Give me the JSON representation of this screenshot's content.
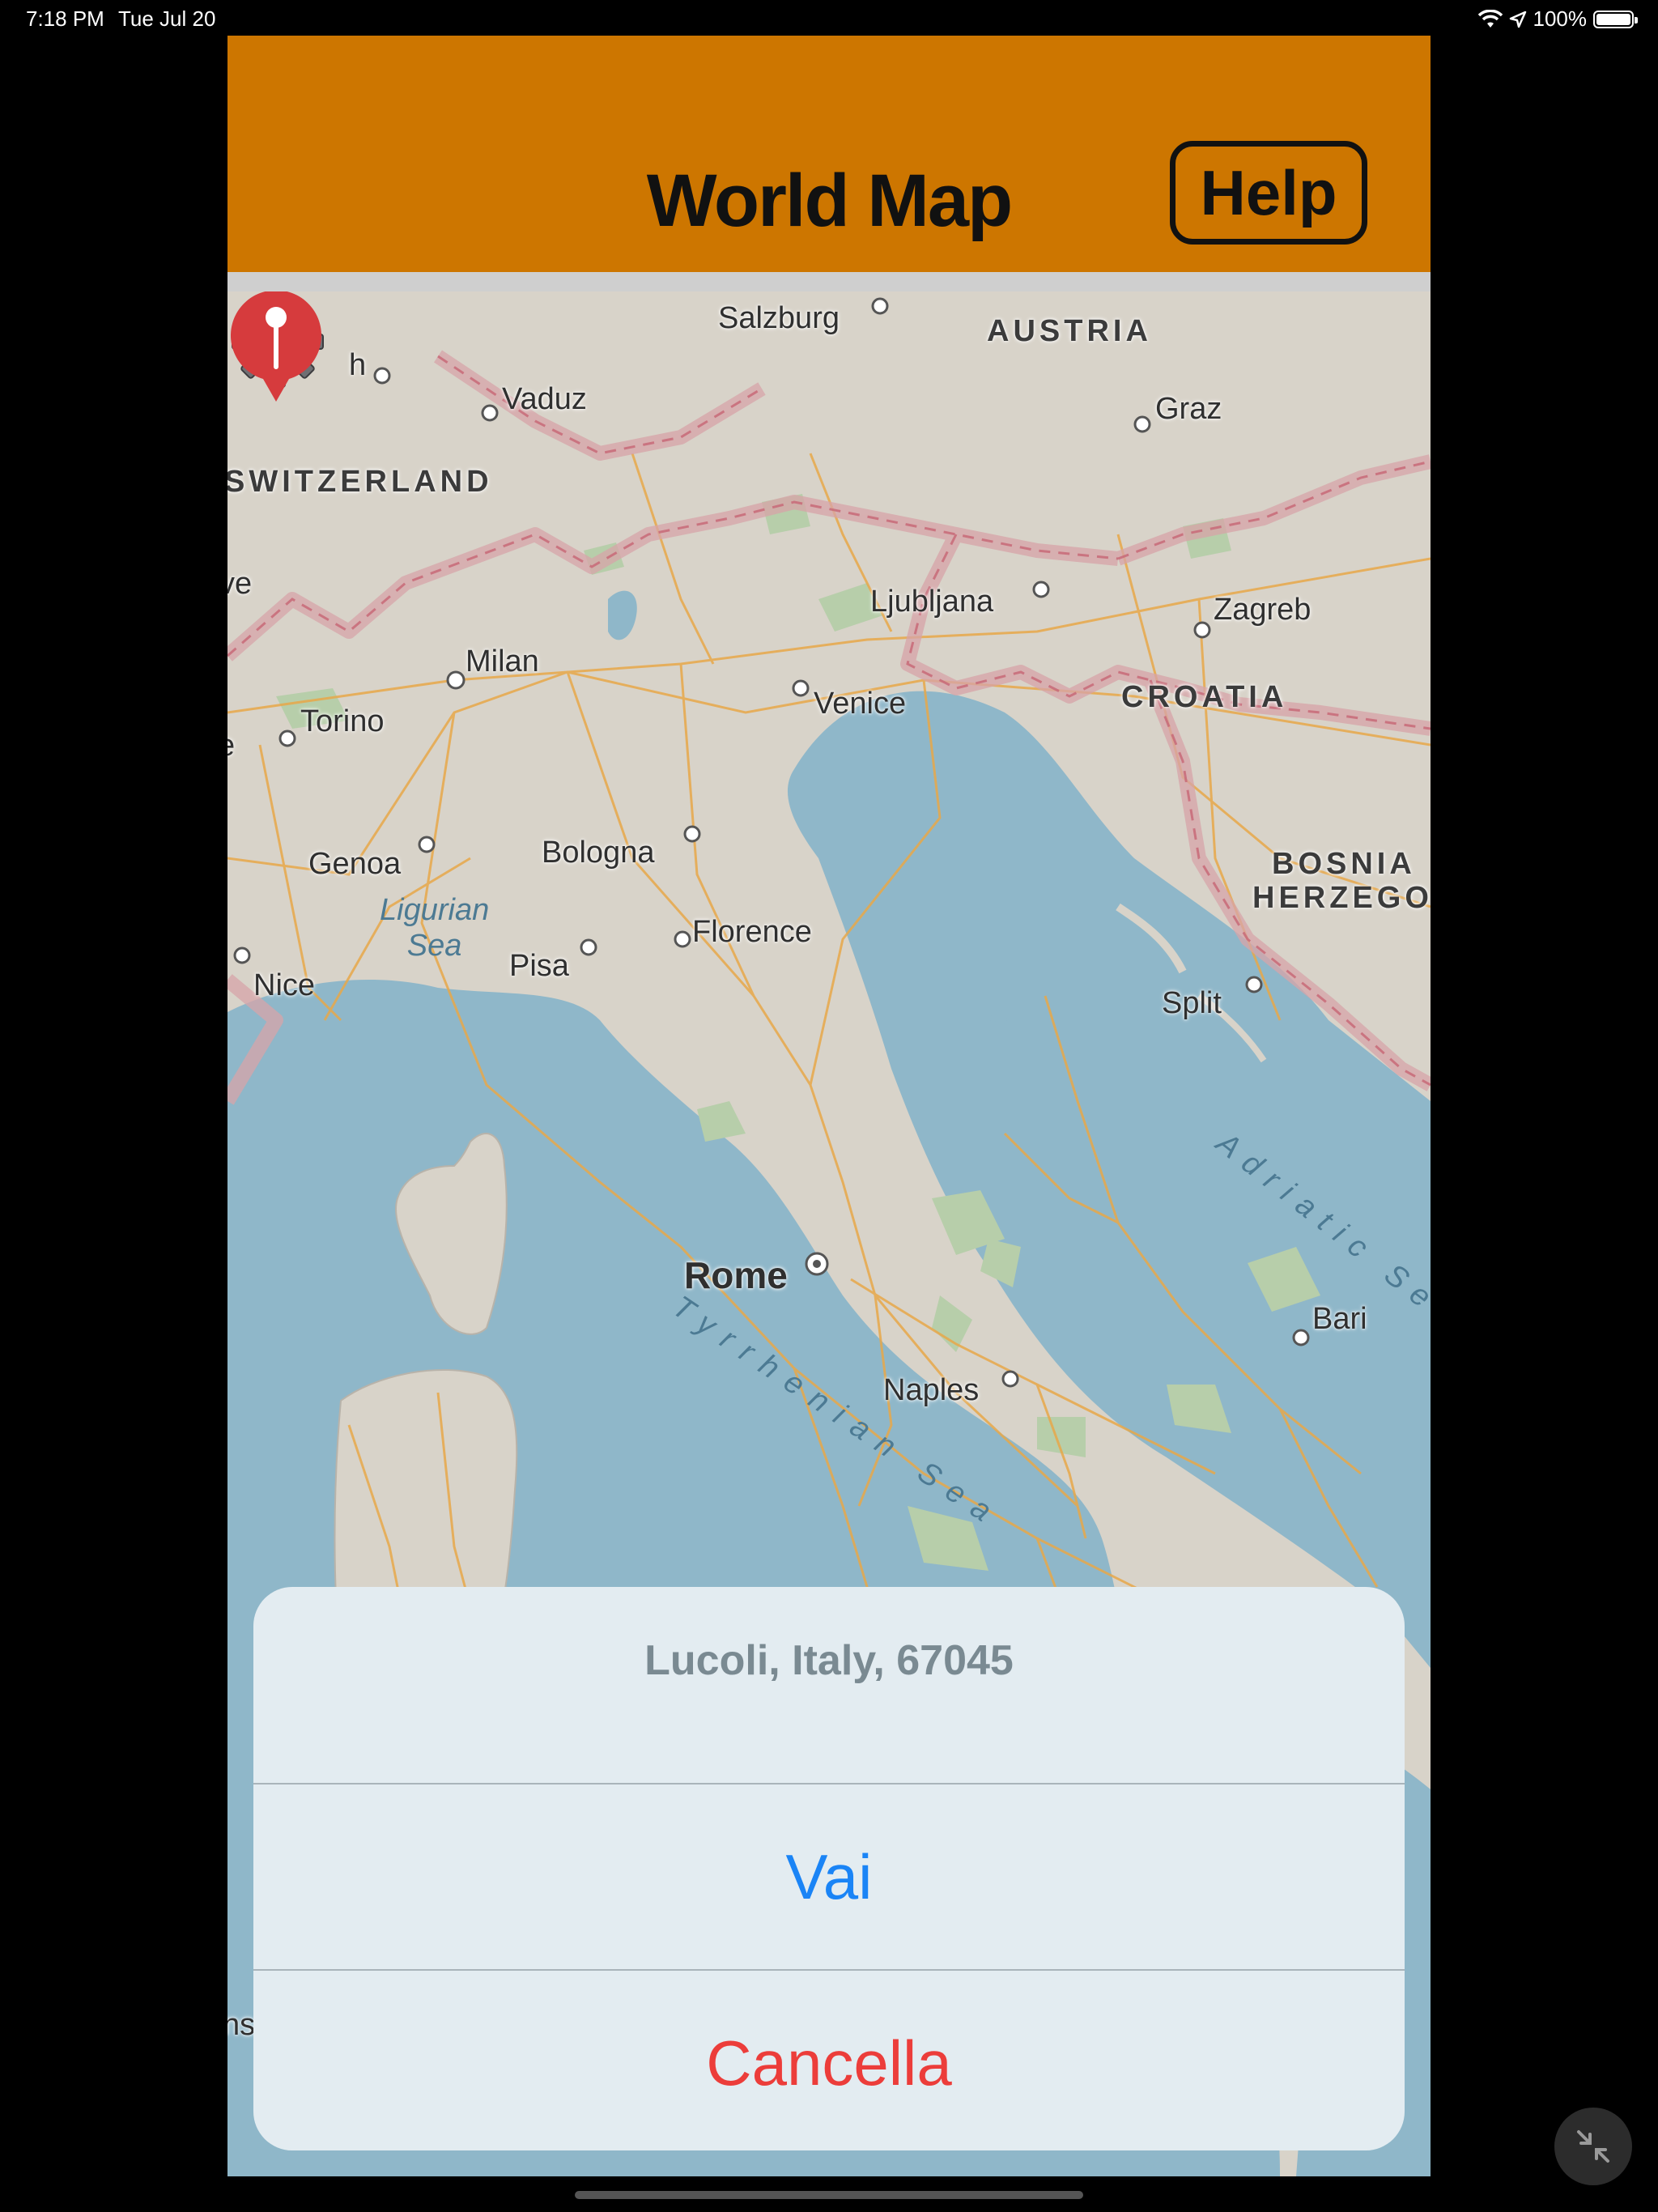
{
  "status_bar": {
    "time": "7:18 PM",
    "date": "Tue Jul 20",
    "battery": "100%",
    "battery_level": 1.0
  },
  "header": {
    "title": "World Map",
    "help_label": "Help",
    "color": "#cd7600"
  },
  "map": {
    "labels": {
      "salzburg": "Salzburg",
      "austria": "AUSTRIA",
      "vaduz": "Vaduz",
      "graz": "Graz",
      "switzerland": "SWITZERLAND",
      "ljubljana": "Ljubljana",
      "zagreb": "Zagreb",
      "milan": "Milan",
      "venice": "Venice",
      "croatia": "CROATIA",
      "torino": "Torino",
      "genoa": "Genoa",
      "bologna": "Bologna",
      "bosnia": "BOSNIA",
      "herzego": "HERZEGO",
      "ligurian_sea": "Ligurian\nSea",
      "florence": "Florence",
      "nice": "Nice",
      "pisa": "Pisa",
      "split": "Split",
      "adriatic_sea": "Adriatic Sea",
      "rome": "Rome",
      "bari": "Bari",
      "tyrrhenian_sea": "Tyrrhenian Sea",
      "naples": "Naples",
      "edge_h": "h",
      "edge_ve": "ve",
      "edge_e": "e",
      "edge_ns": "ns"
    }
  },
  "action_sheet": {
    "title": "Lucoli, Italy, 67045",
    "go_label": "Vai",
    "cancel_label": "Cancella"
  },
  "icons": {
    "settings": "gear-icon",
    "pin": "map-pin-icon",
    "minimize": "minimize-arrows-icon",
    "wifi": "wifi-icon",
    "location": "location-arrow-icon",
    "battery": "battery-icon"
  }
}
